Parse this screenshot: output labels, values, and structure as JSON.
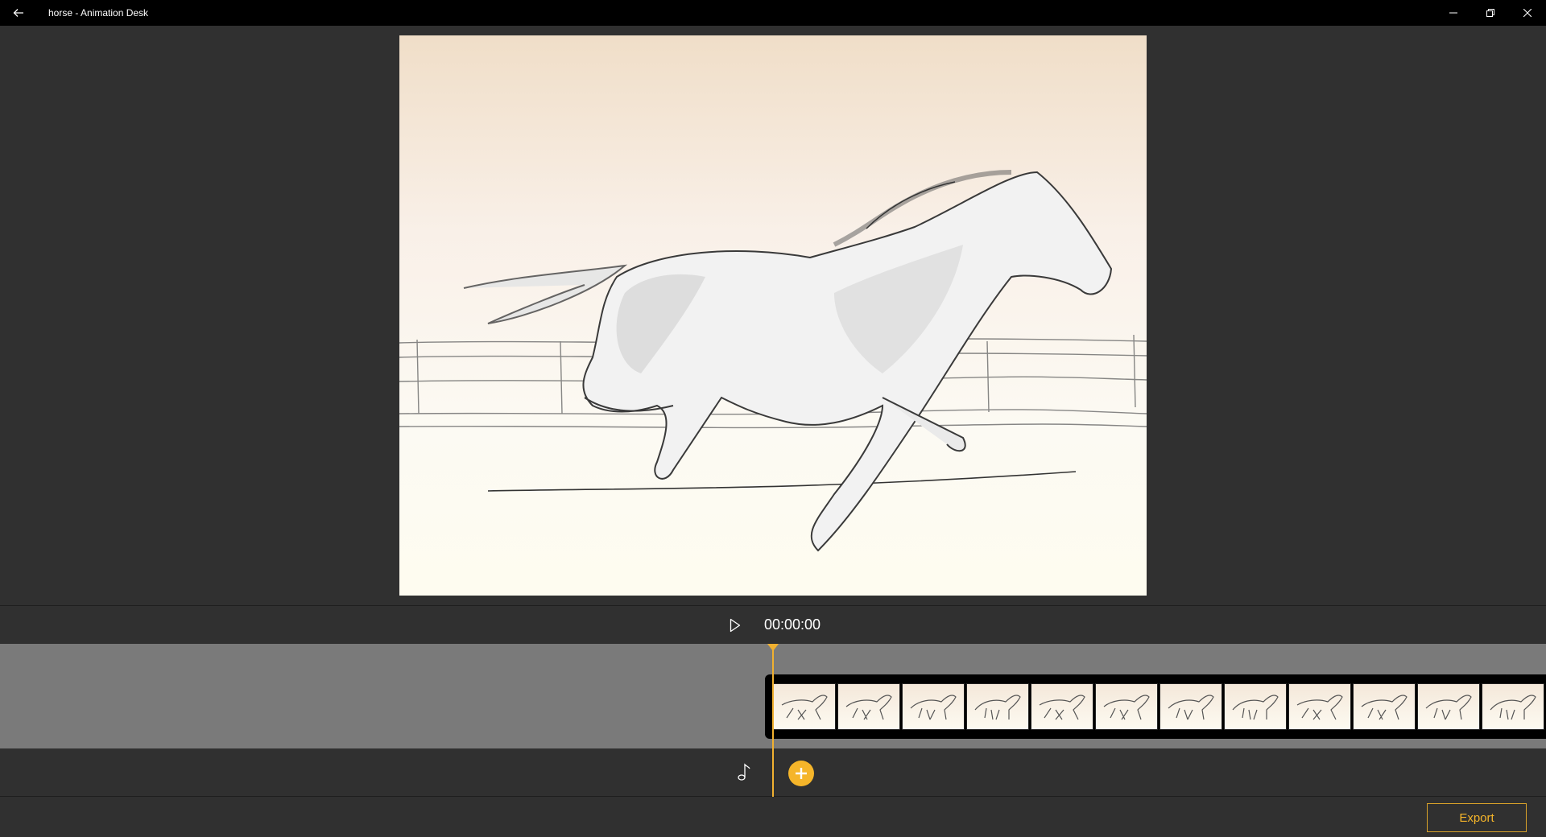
{
  "window": {
    "title": "horse - Animation Desk",
    "back_icon": "arrow-left-icon",
    "controls": [
      "minimize-icon",
      "restore-icon",
      "close-icon"
    ]
  },
  "stage": {
    "drawing": "galloping horse sketch with fence",
    "background_colors": [
      "#f0dec8",
      "#fefcf0"
    ]
  },
  "playback": {
    "play_icon": "play-icon",
    "timecode": "00:00:00"
  },
  "timeline": {
    "frame_count_visible": 12,
    "accent_color": "#f0b030"
  },
  "audio": {
    "note_icon": "music-note-icon",
    "add_icon": "plus-circle-icon"
  },
  "footer": {
    "export_label": "Export"
  }
}
